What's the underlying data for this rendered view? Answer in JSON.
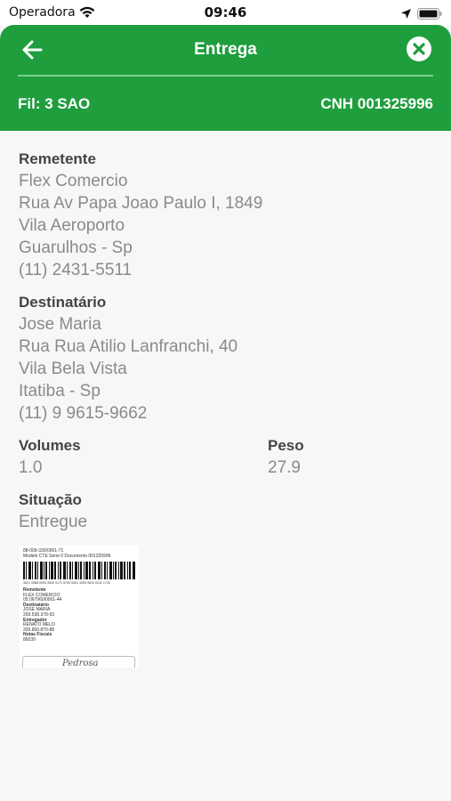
{
  "status_bar": {
    "carrier": "Operadora",
    "time": "09:46"
  },
  "header": {
    "title": "Entrega",
    "branch": "Fil: 3 SAO",
    "license": "CNH 001325996",
    "accent_color": "#1f9e3d"
  },
  "sender": {
    "label": "Remetente",
    "name": "Flex Comercio",
    "address": "Rua Av Papa Joao Paulo I, 1849",
    "district": "Vila Aeroporto",
    "city": "Guarulhos - Sp",
    "phone": "(11) 2431-5511"
  },
  "recipient": {
    "label": "Destinatário",
    "name": "Jose Maria",
    "address": "Rua Rua Atilio Lanfranchi, 40",
    "district": "Vila Bela Vista",
    "city": "Itatiba - Sp",
    "phone": "(11) 9 9615-9662"
  },
  "volumes": {
    "label": "Volumes",
    "value": "1.0"
  },
  "weight": {
    "label": "Peso",
    "value": "27.9"
  },
  "status": {
    "label": "Situação",
    "value": "Entregue"
  },
  "photo": {
    "header_line": "88-009-330/0001-71",
    "model_line": "Modelo CTE   Série 0   Documento 001325996",
    "barcode_number": "3521 0588 0093 3000 0171 5700 0001 3259 9610 0131 1743",
    "lines": [
      "Remetente",
      "FLEX COMERCIO",
      "05.067960/0001-44",
      "Destinatário",
      "JOSE MARIA",
      "293.538.378-93",
      "Entregador",
      "RENATO MELO",
      "326.800.870-88",
      "Notas Fiscais",
      "86039"
    ],
    "signature": "Pedrosa"
  }
}
